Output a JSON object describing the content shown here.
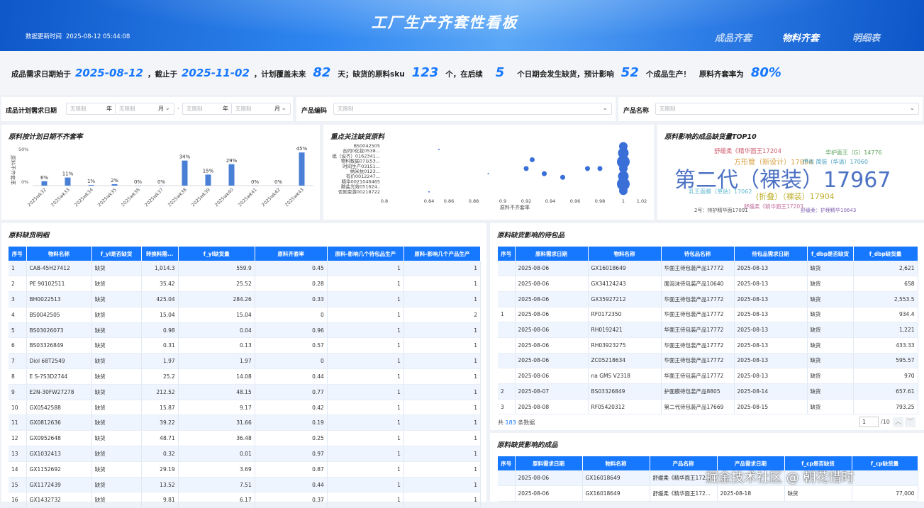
{
  "header": {
    "title": "工厂生产齐套性看板",
    "update_label": "数据更新时间",
    "update_time": "2025-08-12 05:44:08",
    "tabs": [
      {
        "label": "成品齐套"
      },
      {
        "label": "物料齐套"
      },
      {
        "label": "明细表"
      }
    ]
  },
  "summary": {
    "p1": "成品需求日期始于",
    "start_date": "2025-08-12",
    "p2": "，截止于",
    "end_date": "2025-11-02",
    "p3": "，计划覆盖未来",
    "days": "82",
    "p4": "天；缺货的原料sku",
    "sku": "123",
    "p5": "个，在后续",
    "dates": "5",
    "p6": "个日期会发生缺货，预计影响",
    "products": "52",
    "p7": "个成品生产！",
    "p8": "原料齐套率为",
    "rate": "80%"
  },
  "filters": {
    "date_label": "成品计划需求日期",
    "placeholder": "无限制",
    "year": "年",
    "month": "月",
    "dot": "·",
    "code_label": "产品编码",
    "name_label": "产品名称"
  },
  "panels": {
    "chart1_title": "原料按计划日期不齐套率",
    "chart2_title": "重点关注缺货原料",
    "chart3_title": "原料影响的成品缺货量TOP10",
    "detail_title": "原料缺货明细",
    "pending_title": "原料缺货影响的待包品",
    "product_title": "原料缺货影响的成品"
  },
  "chart_data": [
    {
      "type": "bar",
      "title": "原料按计划日期不齐套率",
      "ylabel": "原料不齐套率",
      "ylim": [
        0,
        0.5
      ],
      "yticks": [
        "0%",
        "50%"
      ],
      "categories": [
        "2025wk32",
        "2025wk33",
        "2025wk34",
        "2025wk35",
        "2025wk36",
        "2025wk37",
        "2025wk38",
        "2025wk39",
        "2025wk40",
        "2025wk41",
        "2025wk42",
        "2025wk43"
      ],
      "values": [
        0.06,
        0.11,
        0.01,
        0.02,
        0,
        0,
        0.34,
        0.15,
        0.29,
        0,
        0,
        0.45
      ],
      "labels": [
        "6%",
        "11%",
        "1%",
        "2%",
        "0%",
        "0%",
        "34%",
        "15%",
        "29%",
        "0%",
        "0%",
        "45%"
      ],
      "color": "#4a7fd6"
    },
    {
      "type": "scatter",
      "title": "重点关注缺货原料",
      "xlabel": "原料不齐套率",
      "xticks": [
        "0.8",
        "0.84",
        "0.86",
        "0.88",
        "0.9",
        "0.92",
        "0.94",
        "0.96",
        "0.98",
        "1",
        "1.02"
      ],
      "ylabels": [
        "BS0042505",
        "合同0化妆0538...",
        "纸（设齐）0162341...",
        "物料数据07以53...",
        "时间生产03151...",
        "纳米抗0123...",
        "有价0012247...",
        "精华0021046465",
        "酸盐光效051624..",
        "否则束游00218722"
      ],
      "points": [
        {
          "x": 0.85,
          "y": 0.92
        },
        {
          "x": 0.84,
          "y": 0.1
        },
        {
          "x": 0.89,
          "y": 0.45
        },
        {
          "x": 0.92,
          "y": 0.55
        },
        {
          "x": 0.925,
          "y": 0.72
        },
        {
          "x": 0.935,
          "y": 0.45
        },
        {
          "x": 0.95,
          "y": 0.38
        },
        {
          "x": 0.97,
          "y": 0.55
        },
        {
          "x": 0.98,
          "y": 0.55
        },
        {
          "x": 1,
          "y": 0.98
        },
        {
          "x": 1,
          "y": 0.85
        },
        {
          "x": 1,
          "y": 0.68
        },
        {
          "x": 1,
          "y": 0.55
        },
        {
          "x": 1,
          "y": 0.4
        },
        {
          "x": 1,
          "y": 0.25
        },
        {
          "x": 1,
          "y": 0.12
        }
      ],
      "color": "#3a6fd8"
    },
    {
      "type": "wordcloud",
      "title": "原料影响的成品缺货量TOP10",
      "words": [
        {
          "text": "第二代（裸装）17967",
          "value": 17967,
          "color": "#4e72c4"
        },
        {
          "text": "舒缓柔《精华面王17204",
          "value": 17204,
          "color": "#d06070"
        },
        {
          "text": "华护面王（G）14776",
          "value": 14776,
          "color": "#5aa05a"
        },
        {
          "text": "方形管（新设计）17894",
          "value": 17894,
          "color": "#d8a040"
        },
        {
          "text": "伊尚 简装（华语）17060",
          "value": 17060,
          "color": "#4aa0c0"
        },
        {
          "text": "乳王面膜（单贴）17062",
          "value": 17062,
          "color": "#60b8d0"
        },
        {
          "text": "(折叠）（裸装）17904",
          "value": 17904,
          "color": "#c0b030"
        },
        {
          "text": "舒缓柔《精华面王17203",
          "value": 17203,
          "color": "#c070a0"
        },
        {
          "text": "2号：持护精华面17091",
          "value": 17091,
          "color": "#555"
        },
        {
          "text": "舒缓柔：护理精华10643",
          "value": 10643,
          "color": "#8060b0"
        }
      ]
    }
  ],
  "detail": {
    "headers": [
      "序号",
      "物料名称",
      "f_yl是否缺货",
      "转换料需...",
      "f_yl缺货量",
      "原料齐套率",
      "原料-影响几个待包品生产",
      "原料-影响几个产品生产"
    ],
    "rows": [
      [
        "1",
        "CAB-45H27412",
        "缺货",
        "1,014.3",
        "559.9",
        "0.45",
        "1",
        "1"
      ],
      [
        "2",
        "PE 90102511",
        "缺货",
        "35.42",
        "25.52",
        "0.28",
        "1",
        "1"
      ],
      [
        "3",
        "BH0022513",
        "缺货",
        "425.04",
        "284.26",
        "0.33",
        "1",
        "1"
      ],
      [
        "4",
        "BS0042505",
        "缺货",
        "15.04",
        "15.04",
        "0",
        "1",
        "2"
      ],
      [
        "5",
        "BS03026073",
        "缺货",
        "0.98",
        "0.04",
        "0.96",
        "1",
        "1"
      ],
      [
        "6",
        "BS03326849",
        "缺货",
        "0.31",
        "0.13",
        "0.57",
        "1",
        "1"
      ],
      [
        "7",
        "Diol 68T2549",
        "缺货",
        "1.97",
        "1.97",
        "0",
        "1",
        "1"
      ],
      [
        "8",
        "E S-7S3D2744",
        "缺货",
        "25.2",
        "14.08",
        "0.44",
        "1",
        "1"
      ],
      [
        "9",
        "E2N-30FW27278",
        "缺货",
        "212.52",
        "48.15",
        "0.77",
        "1",
        "1"
      ],
      [
        "10",
        "GX0542588",
        "缺货",
        "15.87",
        "9.17",
        "0.42",
        "1",
        "1"
      ],
      [
        "11",
        "GX0812636",
        "缺货",
        "39.22",
        "31.66",
        "0.19",
        "1",
        "1"
      ],
      [
        "12",
        "GX0952648",
        "缺货",
        "48.71",
        "36.48",
        "0.25",
        "1",
        "1"
      ],
      [
        "13",
        "GX1032413",
        "缺货",
        "0.32",
        "0.01",
        "0.97",
        "1",
        "1"
      ],
      [
        "14",
        "GX1152692",
        "缺货",
        "29.19",
        "3.69",
        "0.87",
        "1",
        "1"
      ],
      [
        "15",
        "GX1172439",
        "缺货",
        "13.52",
        "7.51",
        "0.44",
        "1",
        "1"
      ],
      [
        "16",
        "GX1432732",
        "缺货",
        "9.81",
        "6.17",
        "0.37",
        "1",
        "1"
      ]
    ]
  },
  "pending": {
    "headers": [
      "序号",
      "原料需求日期",
      "物料名称",
      "待包品名称",
      "待包品需求日期",
      "f_dbp是否缺货",
      "f_dbp缺货量"
    ],
    "rows": [
      [
        "",
        "2025-08-06",
        "GX16018649",
        "华面王待包装产品17772",
        "2025-08-13",
        "缺货",
        "2,621"
      ],
      [
        "",
        "2025-08-06",
        "GX34124243",
        "面泡沫待包装产品10640",
        "2025-08-13",
        "缺货",
        "658"
      ],
      [
        "",
        "2025-08-06",
        "GX35927212",
        "华面王待包装产品17772",
        "2025-08-13",
        "缺货",
        "2,553.5"
      ],
      [
        "1",
        "2025-08-06",
        "RF0172350",
        "华面王待包装产品17772",
        "2025-08-13",
        "缺货",
        "934.4"
      ],
      [
        "",
        "2025-08-06",
        "RH0192421",
        "华面王待包装产品17772",
        "2025-08-13",
        "缺货",
        "1,221"
      ],
      [
        "",
        "2025-08-06",
        "RH03923275",
        "华面王待包装产品17772",
        "2025-08-13",
        "缺货",
        "433.33"
      ],
      [
        "",
        "2025-08-06",
        "ZC05218634",
        "华面王待包装产品17772",
        "2025-08-13",
        "缺货",
        "595.57"
      ],
      [
        "",
        "2025-08-06",
        "na GMS V2318",
        "华面王待包装产品17772",
        "2025-08-13",
        "缺货",
        "970"
      ],
      [
        "2",
        "2025-08-07",
        "BS03326849",
        "护面膜待包装产品8805",
        "2025-08-14",
        "缺货",
        "657.61"
      ],
      [
        "3",
        "2025-08-08",
        "RF05420312",
        "第二代待包装产品17669",
        "2025-08-15",
        "缺货",
        "793.25"
      ]
    ],
    "total_prefix": "共",
    "total": "183",
    "total_suffix": "条数据",
    "page": "1",
    "pages": "/10"
  },
  "product": {
    "headers": [
      "序号",
      "原料需求日期",
      "物料名称",
      "产品名称",
      "产品需求日期",
      "f_cp是否缺货",
      "f_cp缺货量"
    ],
    "rows": [
      [
        "",
        "2025-08-06",
        "GX16018649",
        "舒缓柔《精华面王172...",
        "",
        "",
        ""
      ],
      [
        "",
        "2025-08-06",
        "GX16018649",
        "舒缓柔《精华面王172...",
        "2025-08-18",
        "缺货",
        "77,000"
      ]
    ]
  },
  "watermark": "掘金技术社区 @ 朝花惜时"
}
